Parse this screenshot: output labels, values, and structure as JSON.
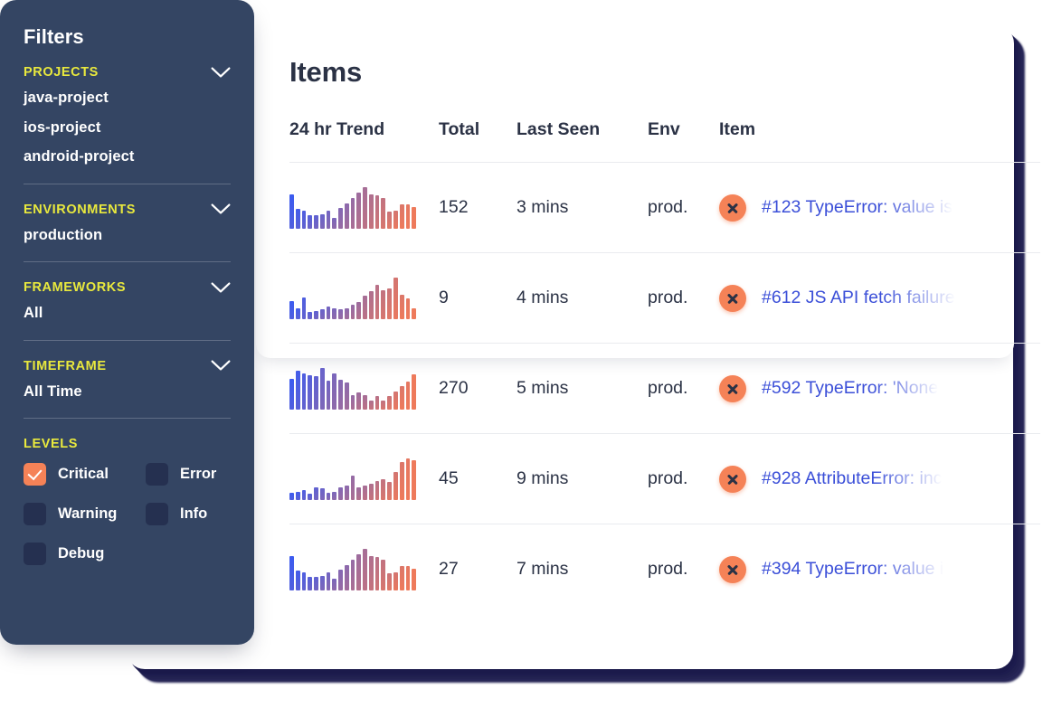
{
  "sidebar": {
    "title": "Filters",
    "groups": [
      {
        "name": "PROJECTS",
        "icon": "chevron-down-icon",
        "items": [
          "java-project",
          "ios-project",
          "android-project"
        ]
      },
      {
        "name": "ENVIRONMENTS",
        "icon": "chevron-down-icon",
        "items": [
          "production"
        ]
      },
      {
        "name": "FRAMEWORKS",
        "icon": "chevron-down-icon",
        "items": [
          "All"
        ]
      },
      {
        "name": "TIMEFRAME",
        "icon": "chevron-down-icon",
        "items": [
          "All Time"
        ]
      }
    ],
    "levels": {
      "title": "LEVELS",
      "options": [
        {
          "label": "Critical",
          "checked": true
        },
        {
          "label": "Error",
          "checked": false
        },
        {
          "label": "Warning",
          "checked": false
        },
        {
          "label": "Info",
          "checked": false
        },
        {
          "label": "Debug",
          "checked": false
        }
      ]
    }
  },
  "main": {
    "title": "Items",
    "columns": [
      "24 hr Trend",
      "Total",
      "Last Seen",
      "Env",
      "Item"
    ],
    "rows": [
      {
        "total": "152",
        "last_seen": "3 mins",
        "env": "prod.",
        "status_icon": "error-x-icon",
        "item": "#123 TypeError: value is",
        "trend": [
          38,
          22,
          20,
          15,
          15,
          16,
          20,
          12,
          23,
          28,
          34,
          40,
          46,
          38,
          37,
          34,
          19,
          20,
          27,
          27,
          24
        ]
      },
      {
        "total": "9",
        "last_seen": "4 mins",
        "env": "prod.",
        "status_icon": "error-x-icon",
        "item": "#612 JS API fetch failure",
        "trend": [
          20,
          12,
          24,
          8,
          9,
          11,
          14,
          12,
          11,
          12,
          16,
          19,
          26,
          31,
          38,
          32,
          34,
          46,
          27,
          23,
          12
        ]
      },
      {
        "total": "270",
        "last_seen": "5 mins",
        "env": "prod.",
        "status_icon": "error-x-icon",
        "item": "#592 TypeError:  'None",
        "trend": [
          28,
          35,
          33,
          31,
          30,
          38,
          26,
          33,
          27,
          24,
          13,
          15,
          13,
          8,
          12,
          8,
          12,
          16,
          21,
          25,
          32
        ]
      },
      {
        "total": "45",
        "last_seen": "9 mins",
        "env": "prod.",
        "status_icon": "error-x-icon",
        "item": "#928 AttributeError: inc",
        "trend": [
          7,
          8,
          10,
          6,
          12,
          11,
          7,
          8,
          12,
          14,
          24,
          12,
          14,
          16,
          19,
          21,
          18,
          28,
          38,
          42,
          40
        ]
      },
      {
        "total": "27",
        "last_seen": "7 mins",
        "env": "prod.",
        "status_icon": "error-x-icon",
        "item": "#394 TypeError: value i",
        "trend": [
          38,
          22,
          20,
          15,
          15,
          16,
          20,
          13,
          23,
          28,
          34,
          40,
          46,
          38,
          37,
          34,
          19,
          20,
          27,
          27,
          24
        ]
      }
    ]
  },
  "colors": {
    "sidebar_bg": "#344563",
    "accent_yellow": "#e9e93d",
    "accent_orange": "#f58257",
    "link_blue": "#3b4fd8",
    "text_dark": "#2b3245",
    "spark_start": "#3b5bf0",
    "spark_end": "#ee7a5b"
  }
}
